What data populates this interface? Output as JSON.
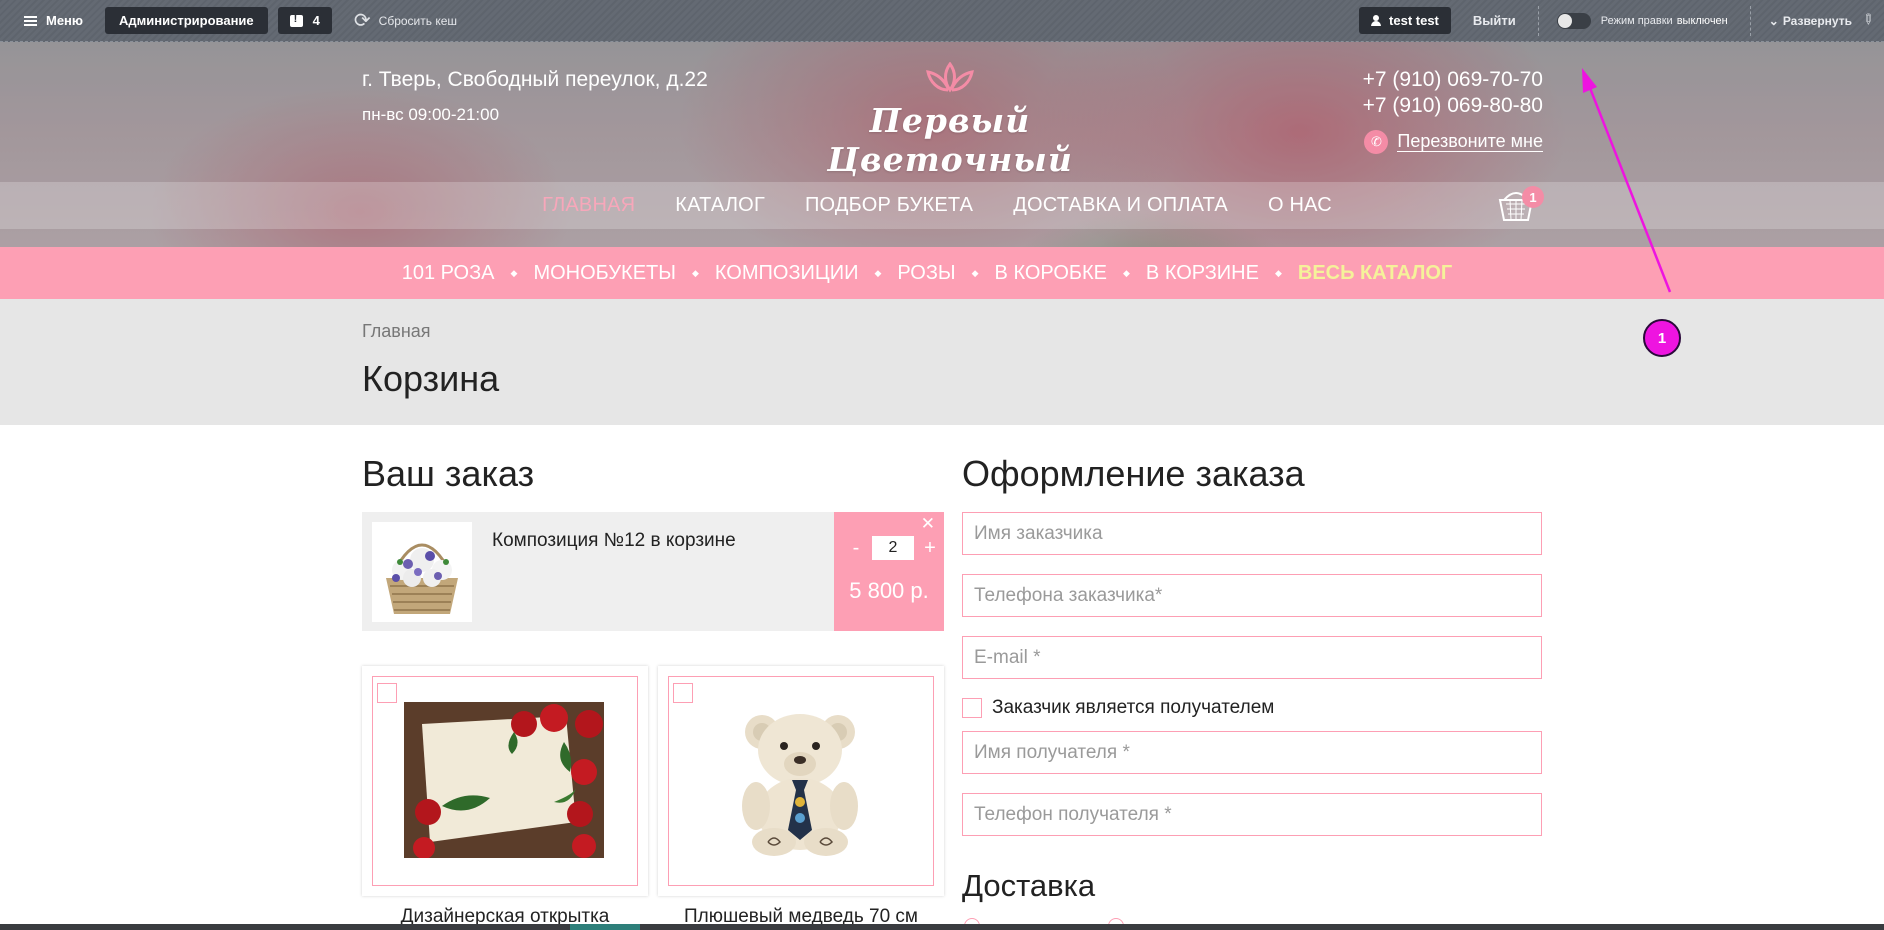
{
  "admin_toolbar": {
    "menu_label": "Меню",
    "admin_label": "Администрирование",
    "notifications_count": "4",
    "reset_cache_label": "Сбросить кеш",
    "user_label": "test test",
    "logout_label": "Выйти",
    "edit_mode_label": "Режим правки",
    "edit_mode_state": "выключен",
    "expand_label": "Развернуть"
  },
  "header": {
    "address": "г. Тверь, Свободный переулок, д.22",
    "hours": "пн-вс 09:00-21:00",
    "logo_text": "Первый Цветочный",
    "phone_1": "+7 (910) 069-70-70",
    "phone_2": "+7 (910) 069-80-80",
    "callback_label": "Перезвоните мне",
    "cart_count": "1"
  },
  "main_nav": {
    "items": [
      {
        "label": "ГЛАВНАЯ",
        "active": true
      },
      {
        "label": "КАТАЛОГ",
        "active": false
      },
      {
        "label": "ПОДБОР БУКЕТА",
        "active": false
      },
      {
        "label": "ДОСТАВКА И ОПЛАТА",
        "active": false
      },
      {
        "label": "О НАС",
        "active": false
      }
    ]
  },
  "category_nav": {
    "items": [
      "101 РОЗА",
      "МОНОБУКЕТЫ",
      "КОМПОЗИЦИИ",
      "РОЗЫ",
      "В КОРОБКЕ",
      "В КОРЗИНЕ"
    ],
    "highlight": "ВЕСЬ КАТАЛОГ"
  },
  "breadcrumb": {
    "home": "Главная"
  },
  "page_title": "Корзина",
  "order": {
    "heading": "Ваш заказ",
    "item": {
      "name": "Композиция №12 в корзине",
      "quantity": "2",
      "minus": "-",
      "plus": "+",
      "price": "5 800 р.",
      "remove": "✕"
    },
    "addons": [
      {
        "title": "Дизайнерская открытка"
      },
      {
        "title": "Плюшевый медведь 70 см"
      }
    ]
  },
  "checkout": {
    "heading": "Оформление заказа",
    "fields": {
      "customer_name": "Имя заказчика",
      "customer_phone": "Телефона заказчика*",
      "email": "E-mail *",
      "recipient_name": "Имя получателя *",
      "recipient_phone": "Телефон получателя *"
    },
    "same_recipient_label": "Заказчик является получателем",
    "delivery_heading": "Доставка"
  },
  "annotation": {
    "marker_label": "1"
  },
  "colors": {
    "accent_pink": "#fd9fb4",
    "highlight_yellow": "#f5f29a",
    "toolbar_gray": "#5e646d",
    "annotation_magenta": "#ee14e0"
  }
}
